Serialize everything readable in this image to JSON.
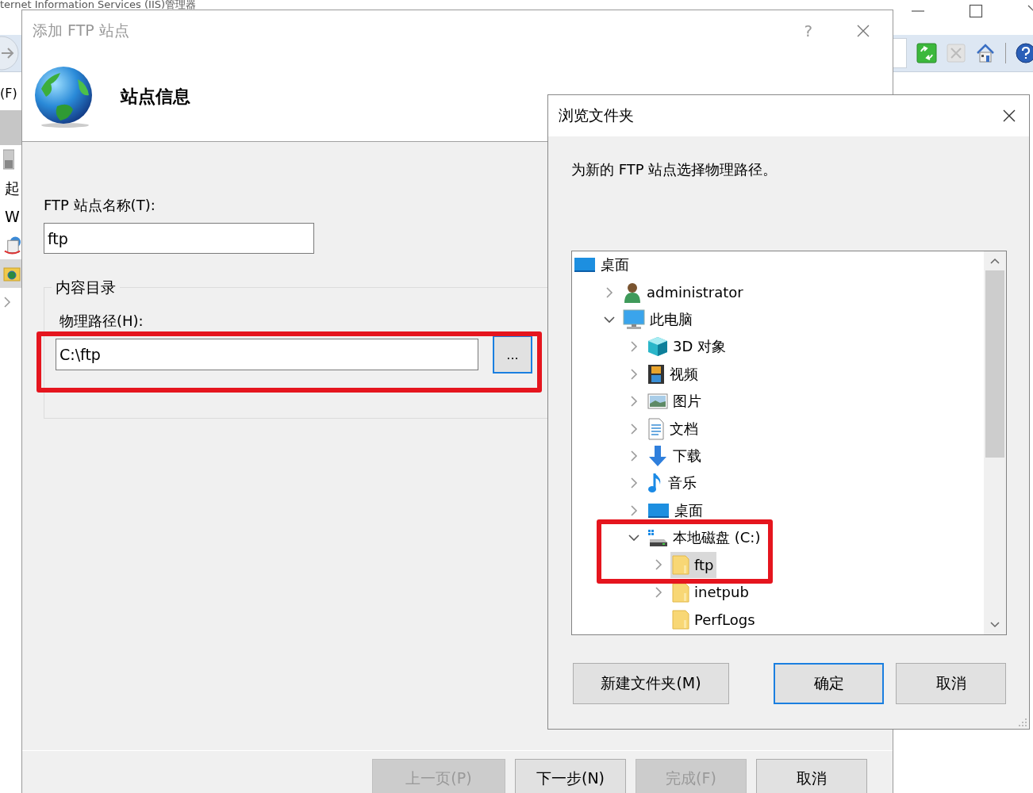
{
  "background_window": {
    "title": "ternet Information Services (IIS)管理器",
    "menu_item": "(F)",
    "side_items": [
      "起",
      "W"
    ]
  },
  "wizard": {
    "title": "添加 FTP 站点",
    "help": "?",
    "heading": "站点信息",
    "site_name": {
      "label": "FTP 站点名称(T):",
      "value": "ftp"
    },
    "content_group": {
      "title": "内容目录",
      "path": {
        "label": "物理路径(H):",
        "value": "C:\\ftp",
        "browse": "..."
      }
    },
    "buttons": [
      {
        "label": "上一页(P)",
        "disabled": true
      },
      {
        "label": "下一步(N)",
        "disabled": false
      },
      {
        "label": "完成(F)",
        "disabled": true
      },
      {
        "label": "取消",
        "disabled": false
      }
    ]
  },
  "browse_dialog": {
    "title": "浏览文件夹",
    "description": "为新的 FTP 站点选择物理路径。",
    "tree": [
      {
        "label": "桌面",
        "kind": "desktop",
        "selected": false,
        "children": [
          {
            "label": "administrator",
            "kind": "user",
            "expanded": false,
            "selected": false
          },
          {
            "label": "此电脑",
            "kind": "computer",
            "expanded": true,
            "selected": false,
            "children": [
              {
                "label": "3D 对象",
                "kind": "cube",
                "expanded": false,
                "selected": false
              },
              {
                "label": "视频",
                "kind": "film",
                "expanded": false,
                "selected": false
              },
              {
                "label": "图片",
                "kind": "picture",
                "expanded": false,
                "selected": false
              },
              {
                "label": "文档",
                "kind": "document",
                "expanded": false,
                "selected": false
              },
              {
                "label": "下载",
                "kind": "download",
                "expanded": false,
                "selected": false
              },
              {
                "label": "音乐",
                "kind": "music",
                "expanded": false,
                "selected": false
              },
              {
                "label": "桌面",
                "kind": "desktop",
                "expanded": false,
                "selected": false
              },
              {
                "label": "本地磁盘 (C:)",
                "kind": "drive",
                "expanded": true,
                "selected": false,
                "children": [
                  {
                    "label": "ftp",
                    "kind": "folder",
                    "expanded": false,
                    "selected": true
                  },
                  {
                    "label": "inetpub",
                    "kind": "folder",
                    "expanded": false,
                    "selected": false
                  },
                  {
                    "label": "PerfLogs",
                    "kind": "folder",
                    "selected": false
                  }
                ]
              }
            ]
          }
        ]
      }
    ],
    "buttons": [
      {
        "label": "新建文件夹(M)",
        "default": false
      },
      {
        "label": "确定",
        "default": true
      },
      {
        "label": "取消",
        "default": false
      }
    ]
  }
}
